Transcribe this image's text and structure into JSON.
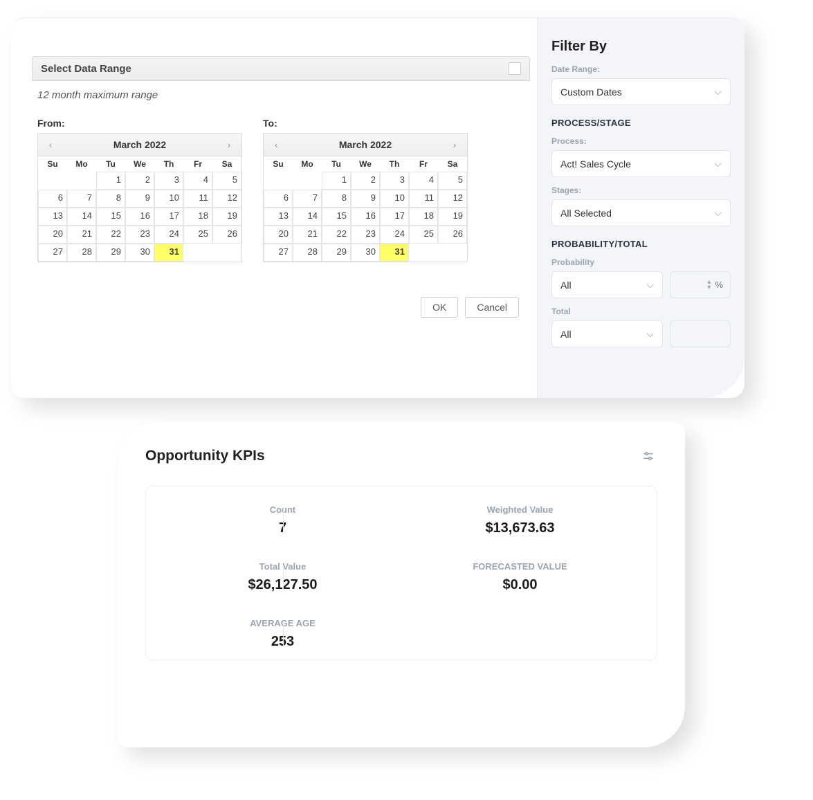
{
  "modal": {
    "title": "Select Data Range",
    "subtitle": "12 month maximum range",
    "from_label": "From:",
    "to_label": "To:",
    "ok": "OK",
    "cancel": "Cancel"
  },
  "calendar": {
    "month_title": "March 2022",
    "dow": [
      "Su",
      "Mo",
      "Tu",
      "We",
      "Th",
      "Fr",
      "Sa"
    ],
    "offset": 2,
    "days": 31,
    "selected": 31
  },
  "filter": {
    "title": "Filter By",
    "date_range_label": "Date Range:",
    "date_range_value": "Custom Dates",
    "process_section": "PROCESS/STAGE",
    "process_label": "Process:",
    "process_value": "Act! Sales Cycle",
    "stages_label": "Stages:",
    "stages_value": "All Selected",
    "probtotal_section": "PROBABILITY/TOTAL",
    "probability_label": "Probability",
    "probability_value": "All",
    "percent_suffix": "%",
    "total_label": "Total",
    "total_value": "All"
  },
  "kpi": {
    "title": "Opportunity KPIs",
    "cells": [
      {
        "label": "Count",
        "value": "7"
      },
      {
        "label": "Weighted Value",
        "value": "$13,673.63"
      },
      {
        "label": "Total Value",
        "value": "$26,127.50"
      },
      {
        "label": "FORECASTED VALUE",
        "value": "$0.00"
      },
      {
        "label": "AVERAGE AGE",
        "value": "253"
      },
      {
        "label": "",
        "value": ""
      }
    ]
  }
}
